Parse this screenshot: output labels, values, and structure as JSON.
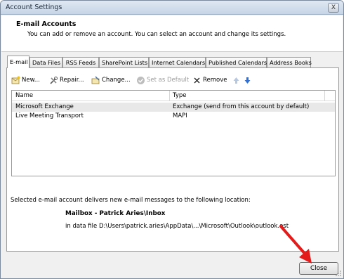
{
  "window": {
    "title": "Account Settings",
    "close_glyph": "X"
  },
  "header": {
    "title": "E-mail Accounts",
    "description": "You can add or remove an account. You can select an account and change its settings."
  },
  "tabs": [
    {
      "label": "E-mail"
    },
    {
      "label": "Data Files"
    },
    {
      "label": "RSS Feeds"
    },
    {
      "label": "SharePoint Lists"
    },
    {
      "label": "Internet Calendars"
    },
    {
      "label": "Published Calendars"
    },
    {
      "label": "Address Books"
    }
  ],
  "toolbar": {
    "new_label": "New...",
    "repair_label": "Repair...",
    "change_label": "Change...",
    "set_default_label": "Set as Default",
    "remove_label": "Remove",
    "icons": [
      "new-account-icon",
      "repair-tools-icon",
      "change-account-icon",
      "checkmark-icon",
      "remove-x-icon",
      "move-up-arrow-icon",
      "move-down-arrow-icon"
    ]
  },
  "accounts": {
    "columns": [
      "Name",
      "Type"
    ],
    "rows": [
      {
        "name": "Microsoft Exchange",
        "type": "Exchange (send from this account by default)"
      },
      {
        "name": "Live Meeting Transport",
        "type": "MAPI"
      }
    ]
  },
  "delivery": {
    "text": "Selected e-mail account delivers new e-mail messages to the following location:",
    "mailbox": "Mailbox - Patrick Aries\\Inbox",
    "data_file": "in data file D:\\Users\\patrick.aries\\AppData\\...\\Microsoft\\Outlook\\outlook.ost"
  },
  "footer": {
    "close_label": "Close"
  },
  "colors": {
    "annotation_arrow": "#e31b1b",
    "move_arrow": "#2f6fd6",
    "selected_row": "#e8e8e8"
  }
}
